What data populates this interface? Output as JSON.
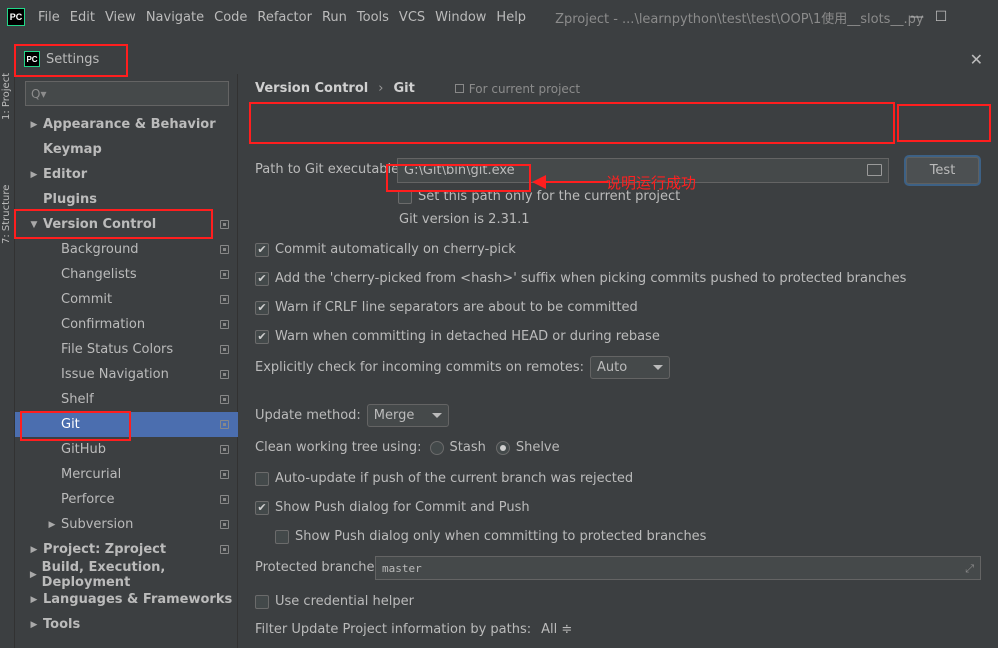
{
  "window": {
    "title": "Zproject - ...\\learnpython\\test\\test\\OOP\\1使用__slots__.py",
    "app_icon": "PC",
    "menu": [
      "File",
      "Edit",
      "View",
      "Navigate",
      "Code",
      "Refactor",
      "Run",
      "Tools",
      "VCS",
      "Window",
      "Help"
    ],
    "controls": {
      "minimize": "—",
      "maximize": "☐"
    }
  },
  "side_strip": {
    "project_label": "1: Project",
    "structure_label": "7: Structure"
  },
  "dialog": {
    "title": "Settings",
    "icon": "PC",
    "close": "✕"
  },
  "tree": {
    "search_placeholder": "Q▾",
    "items": [
      {
        "label": "Appearance & Behavior",
        "bold": true,
        "arrow": "▶",
        "indent": 0
      },
      {
        "label": "Keymap",
        "bold": true,
        "arrow": "",
        "indent": 0
      },
      {
        "label": "Editor",
        "bold": true,
        "arrow": "▶",
        "indent": 0
      },
      {
        "label": "Plugins",
        "bold": true,
        "arrow": "",
        "indent": 0
      },
      {
        "label": "Version Control",
        "bold": true,
        "arrow": "▼",
        "indent": 0
      },
      {
        "label": "Background",
        "indent": 1
      },
      {
        "label": "Changelists",
        "indent": 1
      },
      {
        "label": "Commit",
        "indent": 1
      },
      {
        "label": "Confirmation",
        "indent": 1
      },
      {
        "label": "File Status Colors",
        "indent": 1
      },
      {
        "label": "Issue Navigation",
        "indent": 1
      },
      {
        "label": "Shelf",
        "indent": 1
      },
      {
        "label": "Git",
        "indent": 1,
        "selected": true
      },
      {
        "label": "GitHub",
        "indent": 1
      },
      {
        "label": "Mercurial",
        "indent": 1
      },
      {
        "label": "Perforce",
        "indent": 1
      },
      {
        "label": "Subversion",
        "indent": 1,
        "arrow": "▶"
      },
      {
        "label": "Project: Zproject",
        "bold": true,
        "arrow": "▶",
        "indent": 0
      },
      {
        "label": "Build, Execution, Deployment",
        "bold": true,
        "arrow": "▶",
        "indent": 0
      },
      {
        "label": "Languages & Frameworks",
        "bold": true,
        "arrow": "▶",
        "indent": 0
      },
      {
        "label": "Tools",
        "bold": true,
        "arrow": "▶",
        "indent": 0
      }
    ]
  },
  "content": {
    "breadcrumb": {
      "parent": "Version Control",
      "separator": "›",
      "current": "Git",
      "scope": "For current project"
    },
    "path_label": "Path to Git executable:",
    "path_value": "G:\\Git\\bin\\git.exe",
    "test_button": "Test",
    "set_path_only": "Set this path only for the current project",
    "git_version": "Git version is 2.31.1",
    "options": [
      {
        "label": "Commit automatically on cherry-pick",
        "checked": true
      },
      {
        "label": "Add the 'cherry-picked from <hash>' suffix when picking commits pushed to protected branches",
        "checked": true
      },
      {
        "label": "Warn if CRLF line separators are about to be committed",
        "checked": true
      },
      {
        "label": "Warn when committing in detached HEAD or during rebase",
        "checked": true
      }
    ],
    "incoming_label": "Explicitly check for incoming commits on remotes:",
    "incoming_value": "Auto",
    "update_method_label": "Update method:",
    "update_method_value": "Merge",
    "clean_tree_label": "Clean working tree using:",
    "clean_tree_stash": "Stash",
    "clean_tree_shelve": "Shelve",
    "auto_update": "Auto-update if push of the current branch was rejected",
    "show_push": "Show Push dialog for Commit and Push",
    "show_push_protected": "Show Push dialog only when committing to protected branches",
    "protected_label": "Protected branches:",
    "protected_value": "master",
    "credential_helper": "Use credential helper",
    "filter_label": "Filter Update Project information by paths:",
    "filter_value": "All ≑"
  },
  "annotation": {
    "text": "说明运行成功",
    "color": "#ff1e1e"
  },
  "check_mark": "✔"
}
